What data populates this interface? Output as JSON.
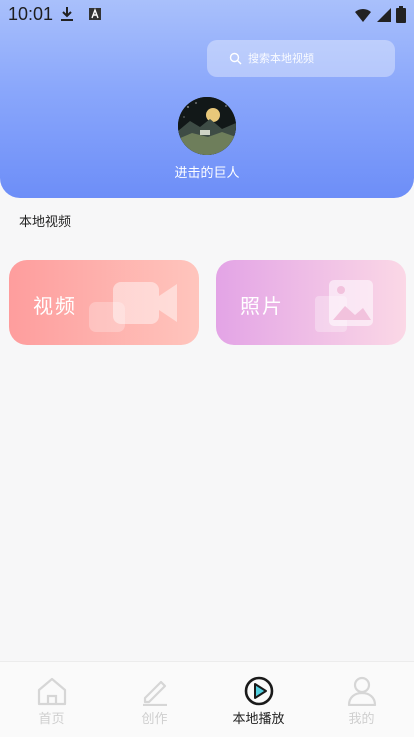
{
  "status_bar": {
    "time": "10:01"
  },
  "header": {
    "search_placeholder": "搜索本地视频",
    "username": "进击的巨人"
  },
  "section": {
    "title": "本地视频"
  },
  "cards": [
    {
      "label": "视频",
      "icon": "video-camera-icon"
    },
    {
      "label": "照片",
      "icon": "photo-icon"
    }
  ],
  "tabbar": {
    "tabs": [
      {
        "label": "首页",
        "icon": "home-icon",
        "active": false
      },
      {
        "label": "创作",
        "icon": "pencil-icon",
        "active": false
      },
      {
        "label": "本地播放",
        "icon": "play-icon",
        "active": true
      },
      {
        "label": "我的",
        "icon": "user-icon",
        "active": false
      }
    ]
  },
  "colors": {
    "header_top": "#a9c0fb",
    "header_bottom": "#6d8ef8",
    "video_card": "#fe9d9d",
    "photo_card": "#e3a4e6",
    "active_tab_accent": "#52d0e0"
  }
}
